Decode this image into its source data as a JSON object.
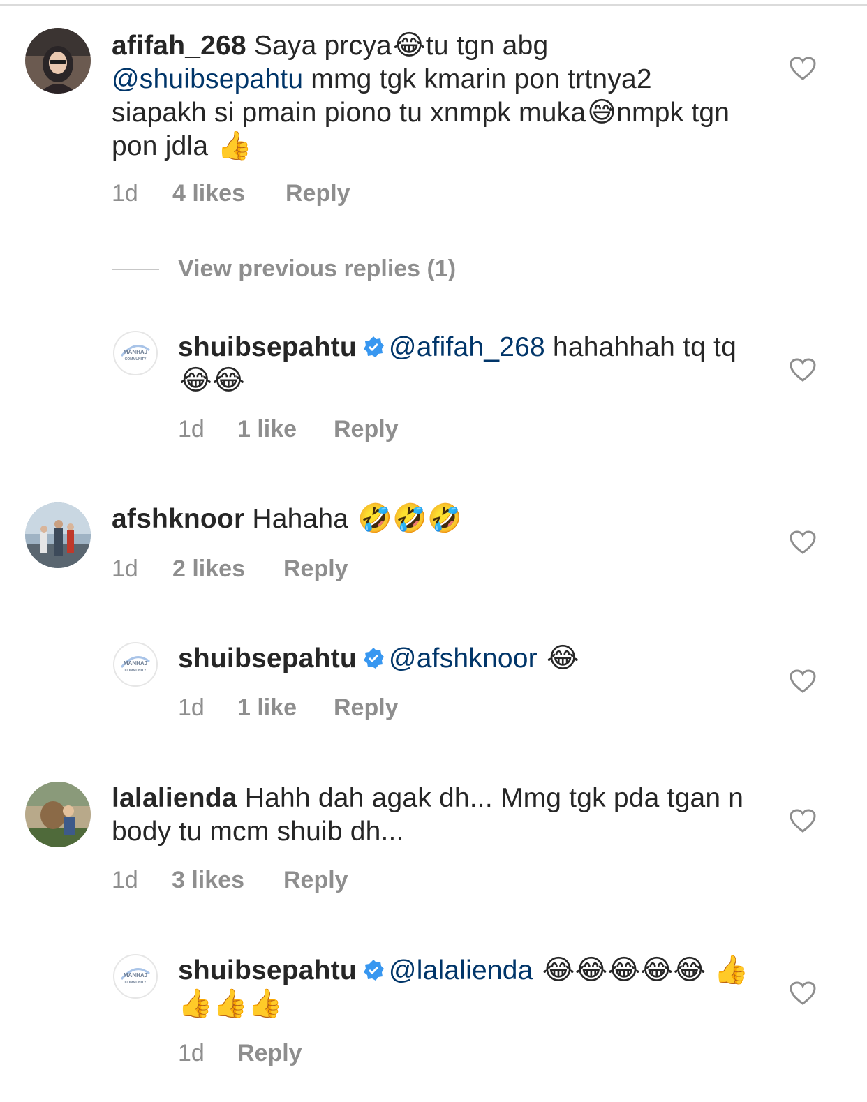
{
  "comments": [
    {
      "username": "afifah_268",
      "text_a": " Saya prcya",
      "emoji_a": "😂",
      "text_b": "tu tgn abg",
      "mention": "@shuibsepahtu",
      "text_c": " mmg tgk kmarin pon trtnya2 siapakh si pmain piono tu xnmpk muka",
      "emoji_b": "😅",
      "text_d": "nmpk tgn pon jdla ",
      "emoji_c": "👍",
      "time": "1d",
      "likes": "4 likes",
      "reply": "Reply"
    },
    {
      "username": "afshknoor",
      "text": " Hahaha ",
      "emojis": "🤣🤣🤣",
      "time": "1d",
      "likes": "2 likes",
      "reply": "Reply"
    },
    {
      "username": "lalalienda",
      "text": " Hahh dah agak dh... Mmg tgk pda tgan n body tu mcm shuib dh...",
      "time": "1d",
      "likes": "3 likes",
      "reply": "Reply"
    }
  ],
  "view_previous": "View previous replies (1)",
  "replies": [
    {
      "username": "shuibsepahtu",
      "mention": "@afifah_268",
      "text": " hahahhah tq tq ",
      "emojis": "😂😂",
      "time": "1d",
      "likes": "1 like",
      "reply": "Reply"
    },
    {
      "username": "shuibsepahtu",
      "mention": "@afshknoor",
      "text": " ",
      "emojis": "😂",
      "time": "1d",
      "likes": "1 like",
      "reply": "Reply"
    },
    {
      "username": "shuibsepahtu",
      "mention": "@lalalienda",
      "text": " ",
      "emojis": "😂😂😂😂😂 👍👍👍👍",
      "time": "1d",
      "reply": "Reply"
    }
  ],
  "logo_text": "MANHAJ COMMUNITY",
  "colors": {
    "mention": "#003569",
    "meta": "#8e8e8e",
    "verified": "#3897f0"
  }
}
